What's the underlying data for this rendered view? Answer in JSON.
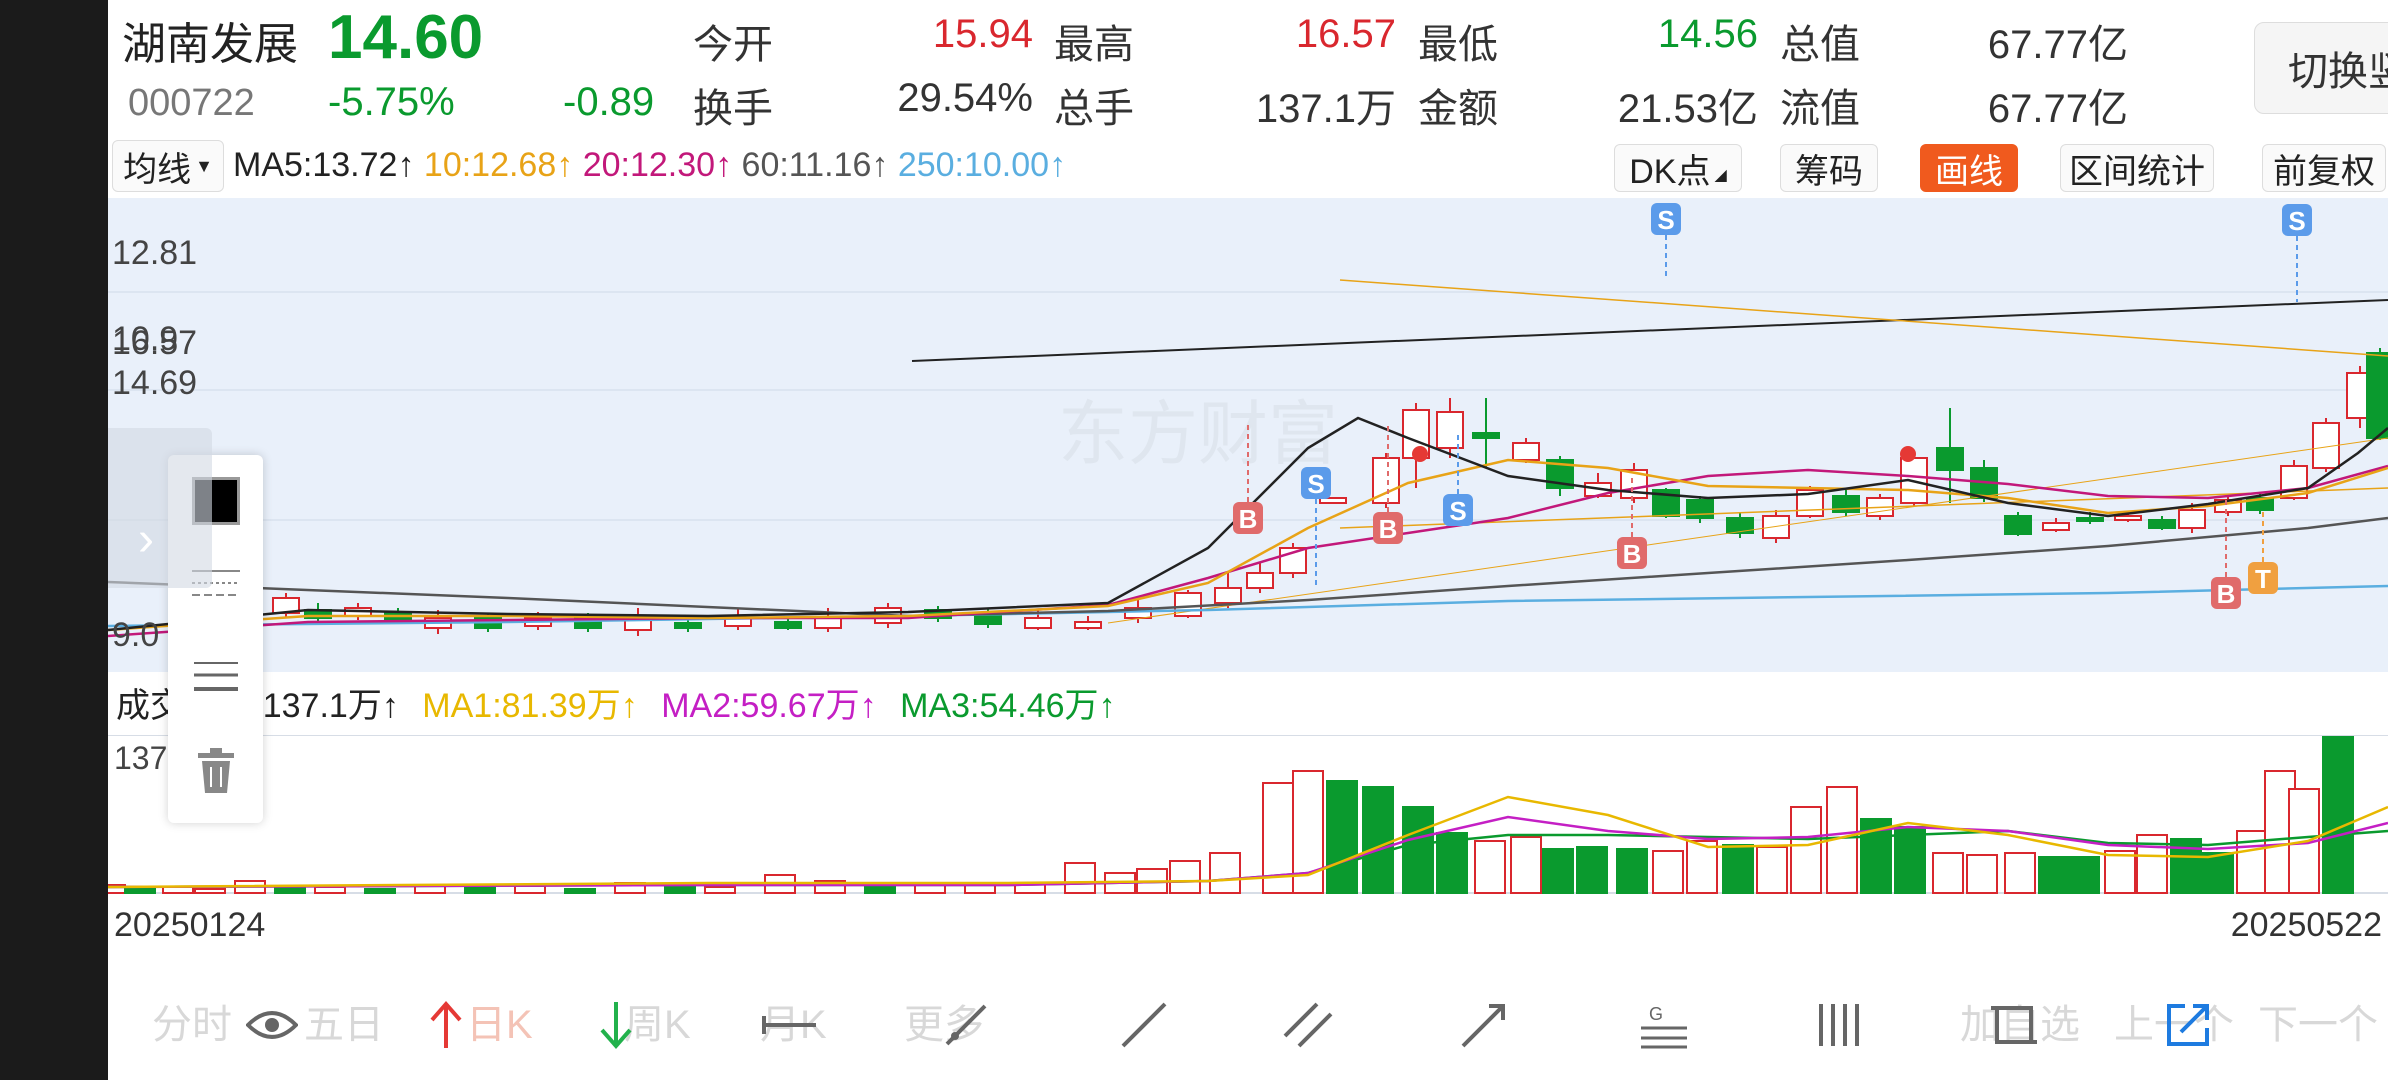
{
  "stock": {
    "name": "湖南发展",
    "code": "000722",
    "price": "14.60",
    "change_pct": "-5.75%",
    "change": "-0.89"
  },
  "quote": [
    {
      "label": "今开",
      "value": "15.94",
      "color": "red"
    },
    {
      "label": "最高",
      "value": "16.57",
      "color": "red"
    },
    {
      "label": "最低",
      "value": "14.56",
      "color": "green"
    },
    {
      "label": "总值",
      "value": "67.77亿",
      "color": "gray"
    },
    {
      "label": "换手",
      "value": "29.54%",
      "color": "gray"
    },
    {
      "label": "总手",
      "value": "137.1万",
      "color": "gray"
    },
    {
      "label": "金额",
      "value": "21.53亿",
      "color": "gray"
    },
    {
      "label": "流值",
      "value": "67.77亿",
      "color": "gray"
    }
  ],
  "portrait_button": "切换竖屏",
  "ma_bar": {
    "selector": "均线",
    "items": [
      {
        "text": "MA5:13.72↑",
        "color": "#222222"
      },
      {
        "text": "10:12.68↑",
        "color": "#e8a317"
      },
      {
        "text": "20:12.30↑",
        "color": "#c2187a"
      },
      {
        "text": "60:11.16↑",
        "color": "#555555"
      },
      {
        "text": "250:10.00↑",
        "color": "#5aaee0"
      }
    ]
  },
  "right_buttons": [
    "DK点",
    "筹码",
    "画线",
    "区间统计",
    "前复权"
  ],
  "price_axis": [
    "16.57",
    "14.69",
    "12.81",
    "10.9",
    "9.0"
  ],
  "volume_bar": {
    "label": "成交量",
    "value": "137.1万↑",
    "items": [
      {
        "text": "MA1:81.39万↑",
        "color": "#e8b800"
      },
      {
        "text": "MA2:59.67万↑",
        "color": "#c41fc4"
      },
      {
        "text": "MA3:54.46万↑",
        "color": "#0a9a2e"
      }
    ],
    "axis_label": "137.1"
  },
  "dates": {
    "start": "20250124",
    "end": "20250522"
  },
  "watermark": "东方财富",
  "markers": {
    "buy": "B",
    "sell": "S",
    "t": "T"
  },
  "bottom_faint": [
    "分时",
    "五日",
    "日K",
    "周K",
    "月K",
    "更多",
    "加自选",
    "上一个",
    "下一个"
  ],
  "drawing_tools": [
    "eye-icon",
    "arrow-up-icon",
    "arrow-down-icon",
    "line-segment-icon",
    "ray-line-icon",
    "straight-line-icon",
    "parallel-line-icon",
    "arrow-line-icon",
    "fibonacci-icon",
    "vertical-lines-icon",
    "rectangle-icon",
    "share-icon"
  ],
  "colors": {
    "up": "#d9272e",
    "down": "#0a9a2e",
    "accent": "#f05a1e",
    "chart_bg": "#e9f0fa",
    "ma5": "#222222",
    "ma10": "#e8a317",
    "ma20": "#c2187a",
    "ma60": "#555555",
    "ma250": "#5aaee0"
  }
}
